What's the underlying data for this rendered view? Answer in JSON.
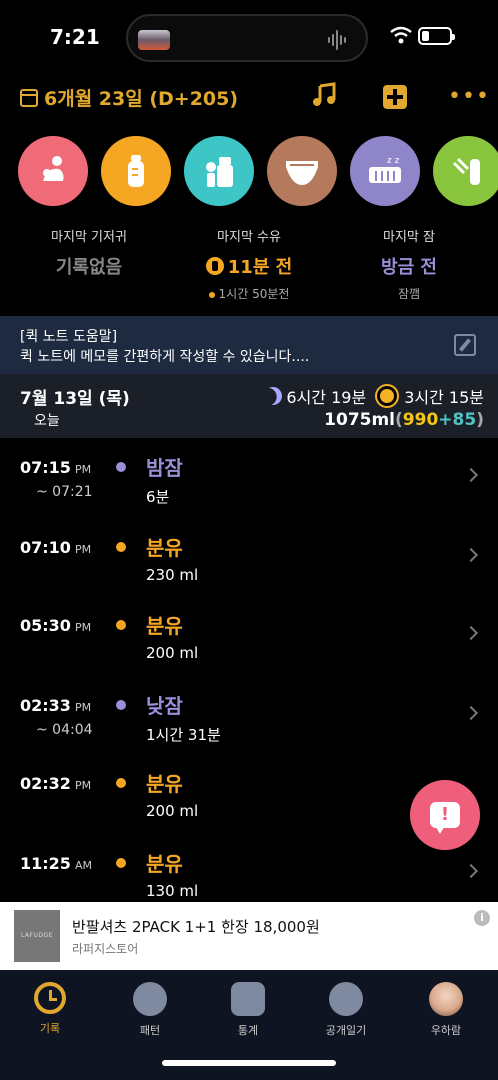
{
  "status_bar": {
    "time": "7:21"
  },
  "header": {
    "date": "6개월 23일 (D+205)"
  },
  "colors": {
    "accent": "#e0a82e",
    "feed": "#f5a623",
    "sleep": "#9b8fd9",
    "formula_count": "#f5c518",
    "solid_count": "#4fc3c3"
  },
  "shortcuts": [
    {
      "name": "breastfeed",
      "icon": "breastfeed-icon",
      "color": "#f06b78"
    },
    {
      "name": "bottle",
      "icon": "bottle-icon",
      "color": "#f5a623"
    },
    {
      "name": "pumping",
      "icon": "pump-icon",
      "color": "#3ec6c6"
    },
    {
      "name": "diaper",
      "icon": "diaper-icon",
      "color": "#b57a5e"
    },
    {
      "name": "sleep",
      "icon": "crib-icon",
      "color": "#8f86c9"
    },
    {
      "name": "solid",
      "icon": "food-icon",
      "color": "#8ac53e"
    }
  ],
  "summary": {
    "diaper": {
      "label": "마지막 기저귀",
      "value": "기록없음"
    },
    "feed": {
      "label": "마지막 수유",
      "value": "11분 전",
      "sub": "1시간 50분전"
    },
    "sleep": {
      "label": "마지막 잠",
      "value": "방금 전",
      "sub": "잠깸"
    }
  },
  "quick_note": {
    "title": "[퀵 노트 도움말]",
    "body": "퀵 노트에 메모를 간편하게 작성할 수 있습니다...."
  },
  "day": {
    "date": "7월 13일 (목)",
    "today": "오늘",
    "night_sleep": "6시간 19분",
    "day_sleep": "3시간 15분",
    "total_ml": "1075ml",
    "paren_open": "(",
    "formula_ml": "990",
    "plus": "+",
    "solid_ml": "85",
    "paren_close": ")"
  },
  "timeline": [
    {
      "time": "07:15",
      "ampm": "PM",
      "end": "~ 07:21",
      "type": "밤잠",
      "detail": "6분",
      "kind": "sleep"
    },
    {
      "time": "07:10",
      "ampm": "PM",
      "end": "",
      "type": "분유",
      "detail": "230 ml",
      "kind": "feed"
    },
    {
      "time": "05:30",
      "ampm": "PM",
      "end": "",
      "type": "분유",
      "detail": "200 ml",
      "kind": "feed"
    },
    {
      "time": "02:33",
      "ampm": "PM",
      "end": "~ 04:04",
      "type": "낮잠",
      "detail": "1시간 31분",
      "kind": "sleep"
    },
    {
      "time": "02:32",
      "ampm": "PM",
      "end": "",
      "type": "분유",
      "detail": "200 ml",
      "kind": "feed"
    },
    {
      "time": "11:25",
      "ampm": "AM",
      "end": "",
      "type": "분유",
      "detail": "130 ml",
      "kind": "feed"
    }
  ],
  "ad": {
    "logo_text": "LAFUDGE",
    "title": "반팔셔츠 2PACK 1+1 한장 18,000원",
    "store": "라퍼지스토어",
    "info": "i"
  },
  "tabs": [
    {
      "label": "기록",
      "icon": "alarm-clock-icon",
      "active": true
    },
    {
      "label": "패턴",
      "icon": "pattern-icon"
    },
    {
      "label": "통계",
      "icon": "chart-icon"
    },
    {
      "label": "공개일기",
      "icon": "public-diary-icon"
    },
    {
      "label": "우하람",
      "icon": "baby-avatar"
    }
  ]
}
